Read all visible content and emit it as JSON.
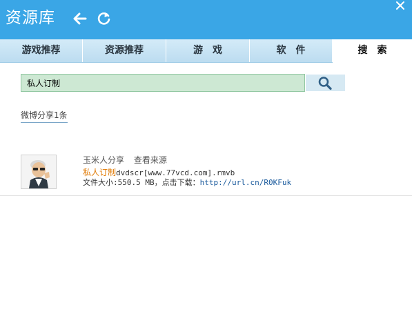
{
  "app": {
    "title": "资源库"
  },
  "tabs": [
    {
      "label": "游戏推荐"
    },
    {
      "label": "资源推荐"
    },
    {
      "label": "游　戏"
    },
    {
      "label": "软　件"
    },
    {
      "label": "搜　索"
    }
  ],
  "search": {
    "value": "私人订制",
    "placeholder": ""
  },
  "results_summary": "微博分享1条",
  "result": {
    "sharer": "玉米人分享",
    "view_source": "查看来源",
    "keyword": "私人订制",
    "filename_rest": "dvdscr[www.77vcd.com].rmvb",
    "size_label": "文件大小:550.5 MB，点击下载：",
    "link": "http://url.cn/R0KFuk"
  },
  "colors": {
    "titlebar": "#3aa6e6",
    "tabbar": "#c5e2f4",
    "search_bg": "#cde8d3",
    "highlight": "#e07800",
    "link": "#1a5a9c"
  },
  "icons": {
    "back": "arrow-left-icon",
    "refresh": "refresh-icon",
    "close": "close-icon",
    "search": "magnifier-icon"
  }
}
